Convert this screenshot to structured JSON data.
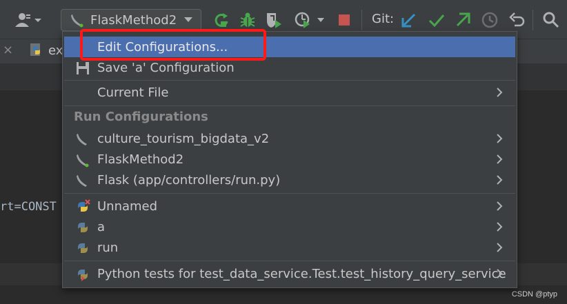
{
  "toolbar": {
    "run_config_label": "FlaskMethod2",
    "git_label": "Git:"
  },
  "editor": {
    "tab_close": "×",
    "tab_file_label": "ex",
    "code_fragment": "rt=CONST"
  },
  "menu": {
    "items_top": [
      {
        "label": "Edit Configurations...",
        "icon": "none",
        "selected": true
      },
      {
        "label": "Save 'a' Configuration",
        "icon": "save-icon",
        "selected": false
      }
    ],
    "current_file": {
      "label": "Current File"
    },
    "run_configurations_header": "Run Configurations",
    "flask_configs": [
      {
        "label": "culture_tourism_bigdata_v2",
        "icon": "flask-horn-icon",
        "active_dot": false
      },
      {
        "label": "FlaskMethod2",
        "icon": "flask-horn-icon",
        "active_dot": true
      },
      {
        "label": "Flask (app/controllers/run.py)",
        "icon": "flask-horn-icon",
        "active_dot": false
      }
    ],
    "python_configs": [
      {
        "label": "Unnamed",
        "icon": "python-error-icon"
      },
      {
        "label": "a",
        "icon": "python-icon"
      },
      {
        "label": "run",
        "icon": "python-icon"
      }
    ],
    "tests_config": {
      "label": "Python tests for test_data_service.Test.test_history_query_service",
      "icon": "python-test-icon"
    }
  },
  "colors": {
    "selection": "#4b6eaf",
    "highlight_box": "#ff1a1a",
    "run_green": "#49a64d",
    "stop_red": "#c75450",
    "git_blue": "#3592c4"
  },
  "watermark": "CSDN @ptyp"
}
